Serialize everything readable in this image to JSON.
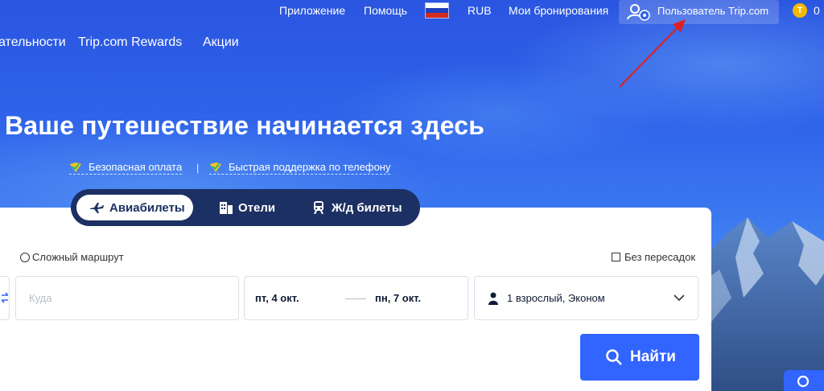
{
  "topbar": {
    "app": "Приложение",
    "help": "Помощь",
    "currency": "RUB",
    "bookings": "Мои бронирования",
    "user": "Пользователь Trip.com",
    "coins_letter": "T",
    "coins": "0",
    "flag_icon": "russia-flag-icon"
  },
  "subnav": {
    "item1": "ательности",
    "item2": "Trip.com Rewards",
    "item3": "Акции"
  },
  "hero": {
    "headline": "Ваше путешествие начинается здесь",
    "feature1": "Безопасная оплата",
    "separator": "|",
    "feature2": "Быстрая поддержка по телефону"
  },
  "tabs": [
    {
      "label": "Авиабилеты",
      "icon": "airplane-icon"
    },
    {
      "label": "Отели",
      "icon": "hotel-icon"
    },
    {
      "label": "Ж/д билеты",
      "icon": "train-icon"
    }
  ],
  "search": {
    "multi_route": "Сложный маршрут",
    "nonstop": "Без пересадок",
    "destination_placeholder": "Куда",
    "depart_date": "пт, 4 окт.",
    "return_date": "пн, 7 окт.",
    "passengers": "1 взрослый, Эконом",
    "button": "Найти"
  },
  "colors": {
    "accent": "#3264ff",
    "tabs_bg": "#1d3063",
    "annotation_arrow": "#e02020"
  }
}
